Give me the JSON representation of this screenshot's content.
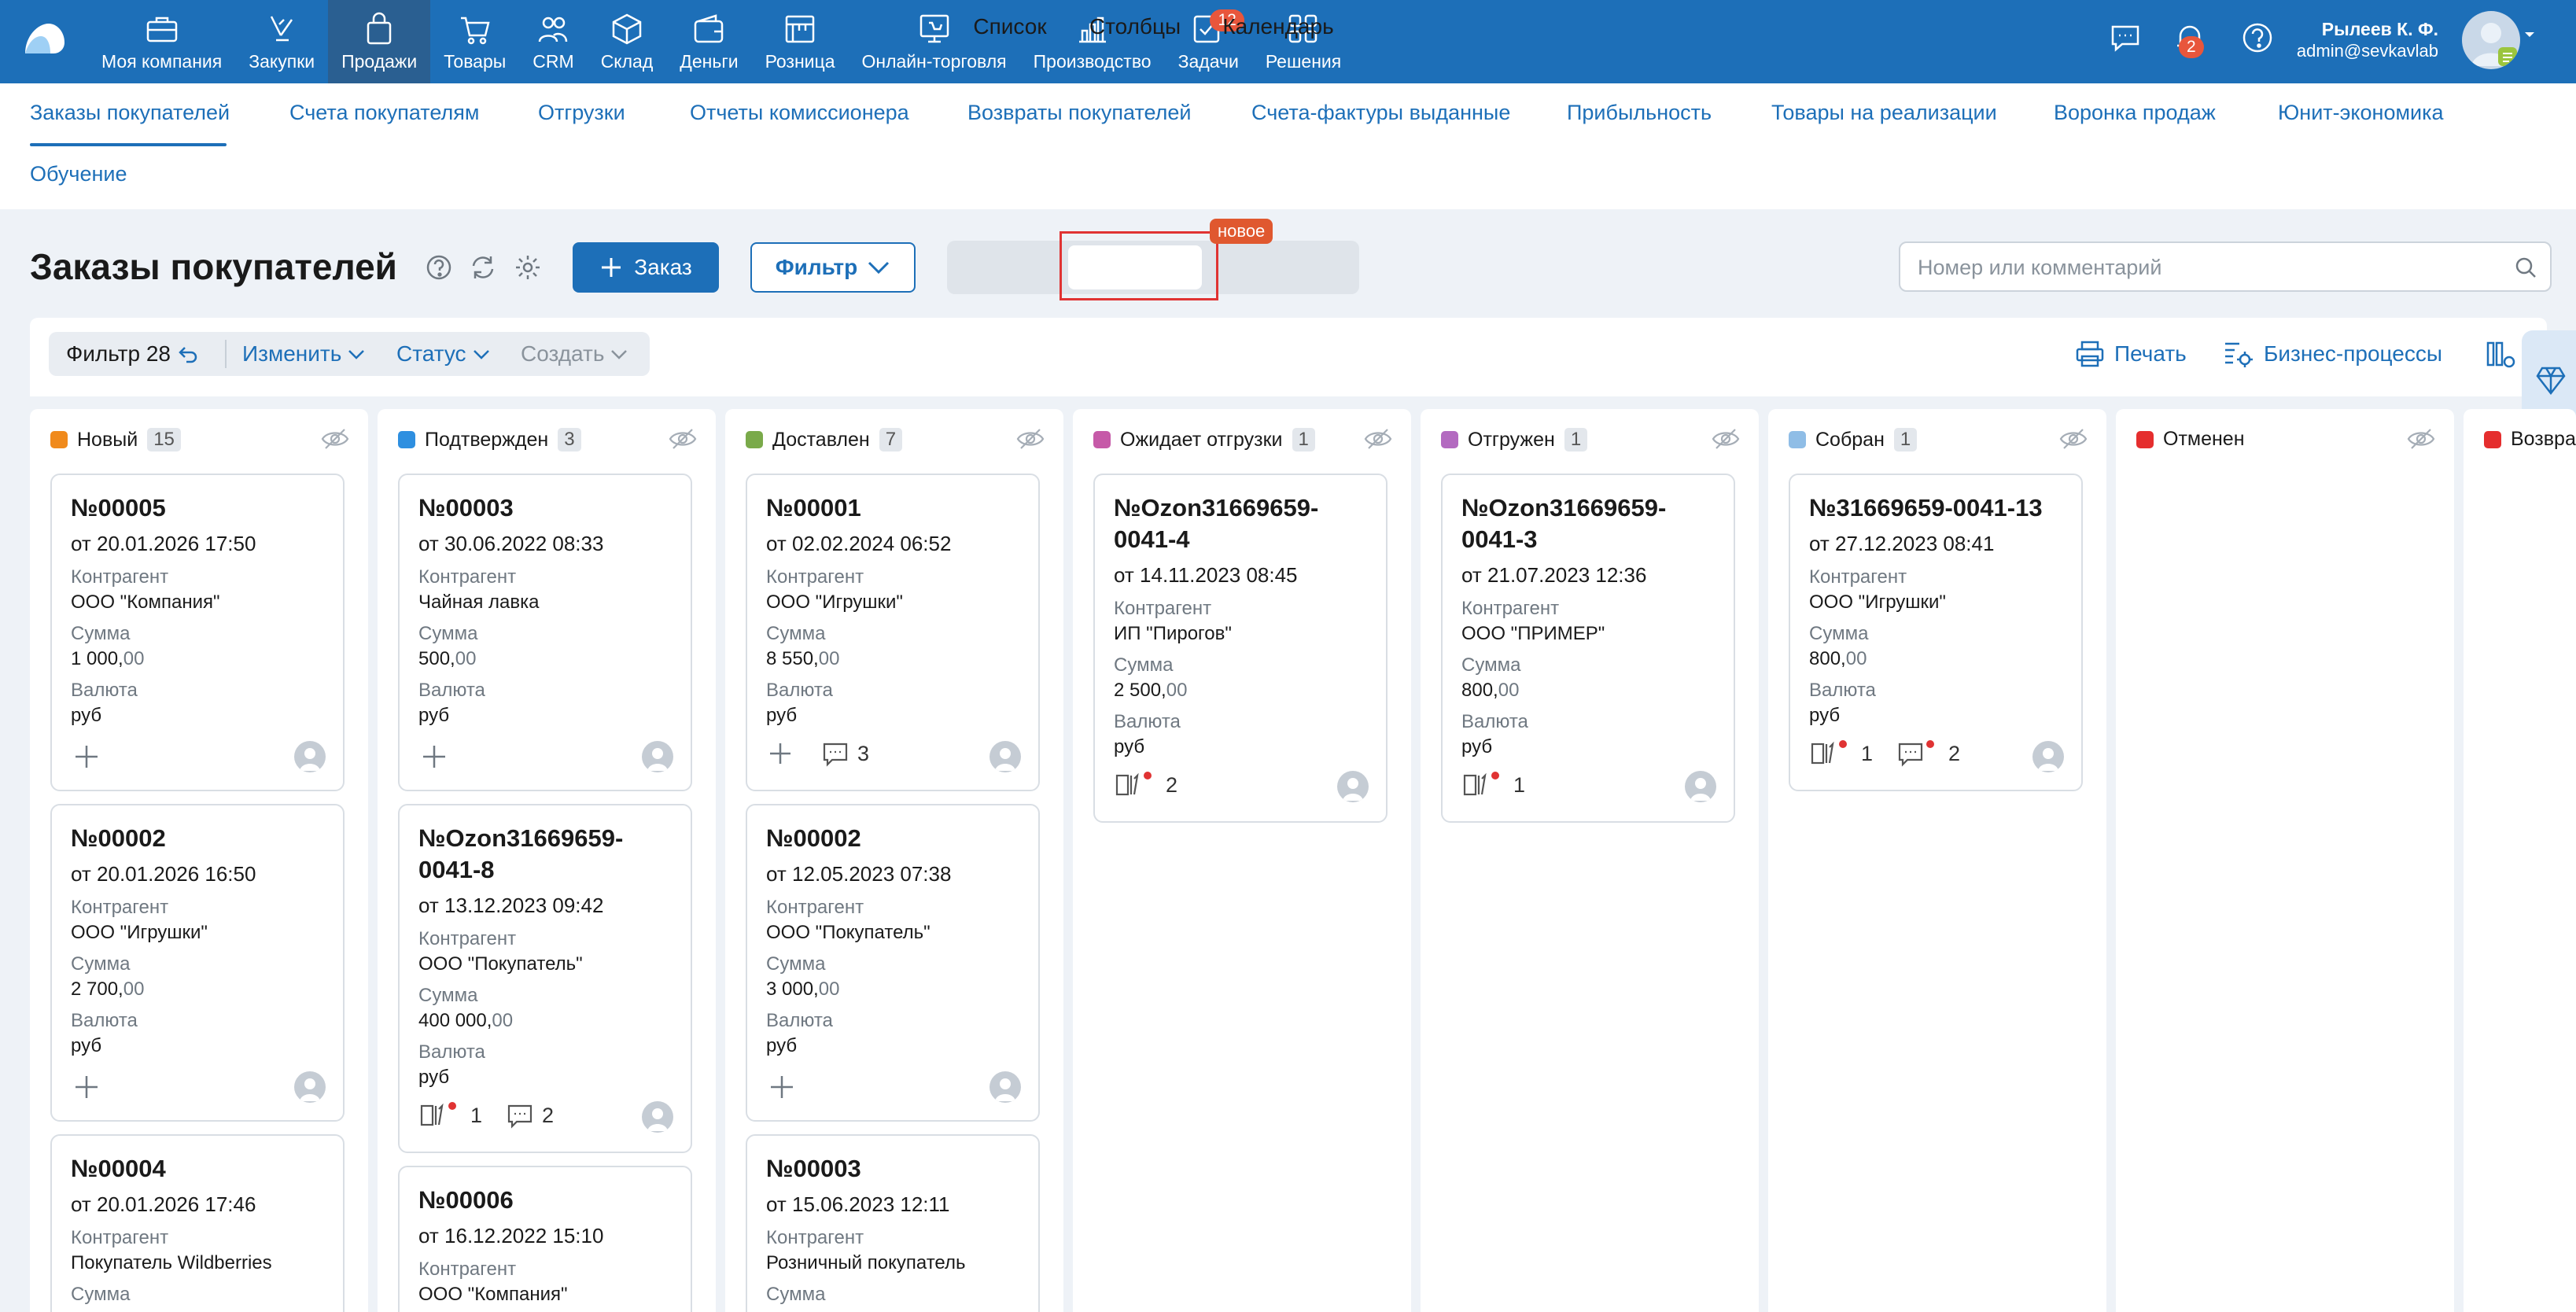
{
  "nav": [
    {
      "label": "Моя компания",
      "icon": "briefcase-icon"
    },
    {
      "label": "Закупки",
      "icon": "purchases-icon"
    },
    {
      "label": "Продажи",
      "icon": "shopping-bag-icon"
    },
    {
      "label": "Товары",
      "icon": "cart-icon"
    },
    {
      "label": "CRM",
      "icon": "people-icon"
    },
    {
      "label": "Склад",
      "icon": "box-icon"
    },
    {
      "label": "Деньги",
      "icon": "wallet-icon"
    },
    {
      "label": "Розница",
      "icon": "store-icon"
    },
    {
      "label": "Онлайн-торговля",
      "icon": "online-store-icon"
    },
    {
      "label": "Производство",
      "icon": "production-icon"
    },
    {
      "label": "Задачи",
      "icon": "tasks-icon",
      "badge": "12"
    },
    {
      "label": "Решения",
      "icon": "apps-icon"
    }
  ],
  "top_right": {
    "notifications_badge": "2",
    "user_name": "Рылеев К. Ф.",
    "user_email": "admin@sevkavlab"
  },
  "subnav": [
    "Заказы покупателей",
    "Счета покупателям",
    "Отгрузки",
    "Отчеты комиссионера",
    "Возвраты покупателей",
    "Счета-фактуры выданные",
    "Прибыльность",
    "Товары на реализации",
    "Воронка продаж",
    "Юнит-экономика",
    "Обучение"
  ],
  "header": {
    "title": "Заказы покупателей",
    "order_button": "Заказ",
    "filter_button": "Фильтр",
    "views": [
      "Список",
      "Столбцы",
      "Календарь"
    ],
    "new_tag": "новое",
    "search_placeholder": "Номер или комментарий"
  },
  "toolbar": {
    "filter_label": "Фильтр 28",
    "edit": "Изменить",
    "status": "Статус",
    "create": "Создать",
    "print": "Печать",
    "business_processes": "Бизнес-процессы"
  },
  "labels": {
    "counterparty": "Контрагент",
    "sum": "Сумма",
    "currency": "Валюта"
  },
  "colors": {
    "accent": "#1d6fb8",
    "new": "#f08a1c",
    "confirmed": "#2e8fe0",
    "delivered": "#7aaa4a",
    "awaiting": "#c65aa8",
    "shipped": "#b36ac0",
    "assembled": "#8fbde6",
    "cancelled": "#e52e2e",
    "returned": "#e52e2e"
  },
  "columns": [
    {
      "name": "Новый",
      "count": "15",
      "color": "#f08a1c",
      "cards": [
        {
          "num": "№00005",
          "date": "от 20.01.2026 17:50",
          "counterparty": "ООО \"Компания\"",
          "sum_main": "1 000,",
          "sum_cents": "00",
          "currency": "руб"
        },
        {
          "num": "№00002",
          "date": "от 20.01.2026 16:50",
          "counterparty": "ООО \"Игрушки\"",
          "sum_main": "2 700,",
          "sum_cents": "00",
          "currency": "руб"
        },
        {
          "num": "№00004",
          "date": "от 20.01.2026 17:46",
          "counterparty": "Покупатель Wildberries"
        }
      ]
    },
    {
      "name": "Подтвержден",
      "count": "3",
      "color": "#2e8fe0",
      "cards": [
        {
          "num": "№00003",
          "date": "от 30.06.2022 08:33",
          "counterparty": "Чайная лавка",
          "sum_main": "500,",
          "sum_cents": "00",
          "currency": "руб"
        },
        {
          "num": "№Ozon31669659-0041-8",
          "date": "от 13.12.2023 09:42",
          "counterparty": "ООО \"Покупатель\"",
          "sum_main": "400 000,",
          "sum_cents": "00",
          "currency": "руб",
          "docs": "1",
          "comments": "2"
        },
        {
          "num": "№00006",
          "date": "от 16.12.2022 15:10",
          "counterparty": "ООО \"Компания\""
        }
      ]
    },
    {
      "name": "Доставлен",
      "count": "7",
      "color": "#7aaa4a",
      "cards": [
        {
          "num": "№00001",
          "date": "от 02.02.2024 06:52",
          "counterparty": "ООО \"Игрушки\"",
          "sum_main": "8 550,",
          "sum_cents": "00",
          "currency": "руб",
          "comments": "3"
        },
        {
          "num": "№00002",
          "date": "от 12.05.2023 07:38",
          "counterparty": "ООО \"Покупатель\"",
          "sum_main": "3 000,",
          "sum_cents": "00",
          "currency": "руб"
        },
        {
          "num": "№00003",
          "date": "от 15.06.2023 12:11",
          "counterparty": "Розничный покупатель"
        }
      ]
    },
    {
      "name": "Ожидает отгрузки",
      "count": "1",
      "color": "#c65aa8",
      "cards": [
        {
          "num": "№Ozon31669659-0041-4",
          "date": "от 14.11.2023 08:45",
          "counterparty": "ИП \"Пирогов\"",
          "sum_main": "2 500,",
          "sum_cents": "00",
          "currency": "руб",
          "docs": "2"
        }
      ]
    },
    {
      "name": "Отгружен",
      "count": "1",
      "color": "#b36ac0",
      "cards": [
        {
          "num": "№Ozon31669659-0041-3",
          "date": "от 21.07.2023 12:36",
          "counterparty": "ООО \"ПРИМЕР\"",
          "sum_main": "800,",
          "sum_cents": "00",
          "currency": "руб",
          "docs": "1"
        }
      ]
    },
    {
      "name": "Собран",
      "count": "1",
      "color": "#8fbde6",
      "cards": [
        {
          "num": "№31669659-0041-13",
          "date": "от 27.12.2023 08:41",
          "counterparty": "ООО \"Игрушки\"",
          "sum_main": "800,",
          "sum_cents": "00",
          "currency": "руб",
          "docs": "1",
          "comments": "2"
        }
      ]
    },
    {
      "name": "Отменен",
      "count": "",
      "color": "#e52e2e",
      "cards": []
    },
    {
      "name": "Возвра",
      "count": "",
      "color": "#e52e2e",
      "cards": []
    }
  ]
}
